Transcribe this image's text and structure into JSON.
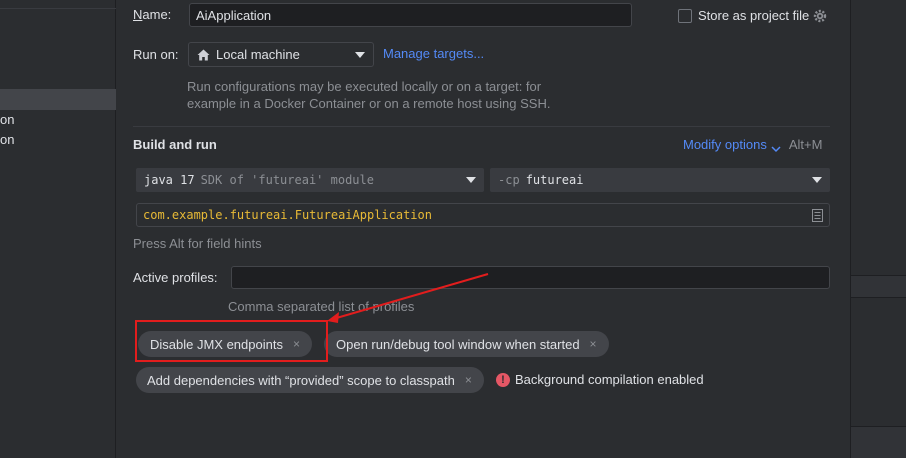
{
  "sidebar": {
    "item1": "on",
    "item2": "on"
  },
  "form": {
    "name_label_prefix": "N",
    "name_label_rest": "ame:",
    "name_value": "AiApplication",
    "store_label": "Store as project file",
    "run_on_label": "Run on:",
    "run_on_value": "Local machine",
    "manage_targets": "Manage targets...",
    "run_on_hint_line1": "Run configurations may be executed locally or on a target: for",
    "run_on_hint_line2": "example in a Docker Container or on a remote host using SSH."
  },
  "build": {
    "title": "Build and run",
    "modify_options": "Modify options",
    "modify_shortcut": "Alt+M",
    "jdk_value": "java 17",
    "jdk_hint": "SDK of 'futureai' module",
    "cp_prefix": "-cp",
    "cp_value": "futureai",
    "main_class": "com.example.futureai.FutureaiApplication",
    "field_hint": "Press Alt for field hints",
    "profiles_label": "Active profiles:",
    "profiles_value": "",
    "profiles_hint": "Comma separated list of profiles"
  },
  "chips": [
    {
      "label": "Disable JMX endpoints",
      "close": "×"
    },
    {
      "label": "Open run/debug tool window when started",
      "close": "×"
    },
    {
      "label": "Add dependencies with “provided” scope to classpath",
      "close": "×"
    }
  ],
  "warning": {
    "icon": "!",
    "text": "Background compilation enabled"
  },
  "colors": {
    "background": "#2b2d30",
    "accent_link": "#548af7",
    "annotation_red": "#e21d1d",
    "chip_bg": "#43454a",
    "warning_red": "#e55765"
  }
}
